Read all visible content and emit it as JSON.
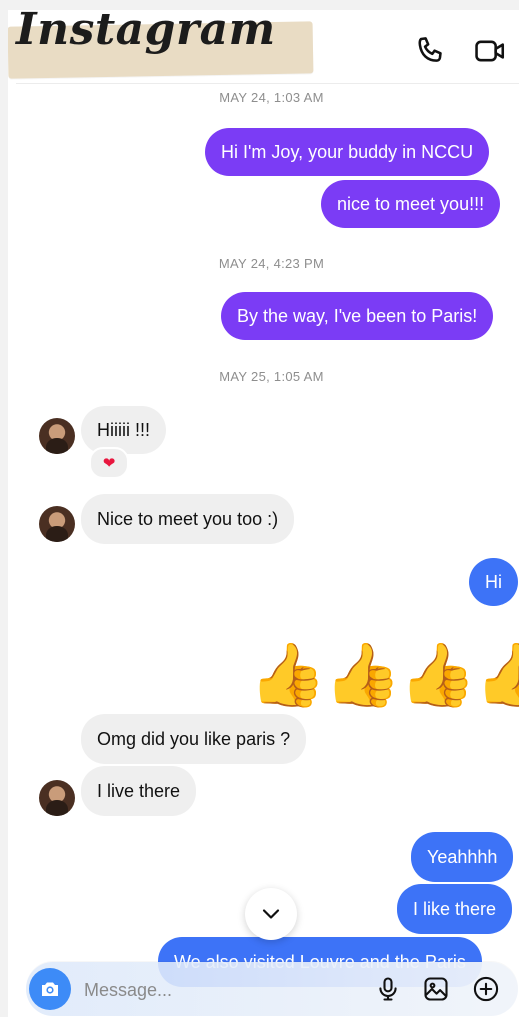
{
  "header": {
    "brand": "Instagram",
    "icons": [
      "phone-icon",
      "video-icon"
    ]
  },
  "timestamps": [
    "MAY 24, 1:03 AM",
    "MAY 24, 4:23 PM",
    "MAY 25, 1:05 AM"
  ],
  "messages": {
    "m1": "Hi I'm Joy, your buddy in NCCU",
    "m2": "nice to meet you!!!",
    "m3": "By the way, I've been to Paris!",
    "m4": "Hiiiii !!!",
    "m4_reaction": "❤",
    "m5": "Nice to meet you too :)",
    "m6": "Hi",
    "m7": "👍👍👍👍",
    "m8": "Omg did you like paris ?",
    "m9": "I live there",
    "m10": "Yeahhhh",
    "m11": "I like there",
    "m12": "We also visited Louvre and the Paris"
  },
  "composer": {
    "placeholder": "Message...",
    "icons": [
      "camera-icon",
      "microphone-icon",
      "gallery-icon",
      "plus-circle-icon"
    ]
  },
  "colors": {
    "outgoing_purple": "#7b3cf5",
    "outgoing_blue": "#3d73f7",
    "incoming": "#efefef",
    "camera_button": "#3d8bf7"
  }
}
